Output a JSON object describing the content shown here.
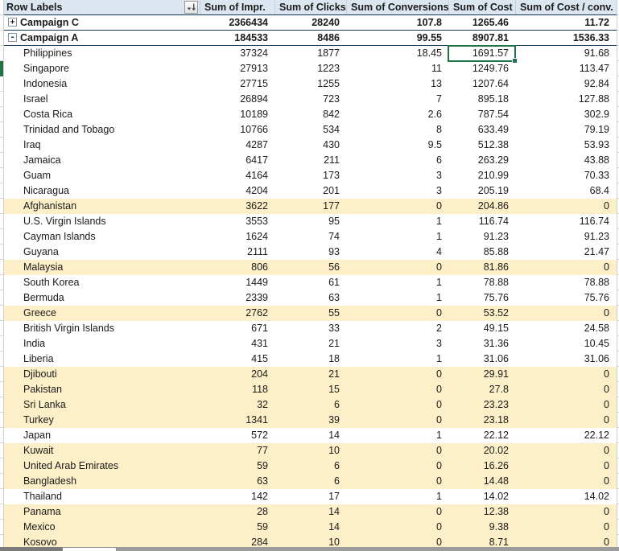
{
  "colors": {
    "header_bg": "#dce6f1",
    "campaign_border": "#17375d",
    "row_highlight": "#fdf0c8",
    "selection_green": "#217346"
  },
  "header": {
    "row_labels": "Row Labels",
    "filter_icon": "sort-filter-dropdown-icon",
    "columns": [
      "Sum of Impr.",
      "Sum of Clicks",
      "Sum of Conversions",
      "Sum of Cost",
      "Sum of Cost / conv."
    ]
  },
  "selection": {
    "row": "Philippines",
    "column": "Sum of Cost",
    "value": "1691.57",
    "row_index": 2,
    "col_index": 4
  },
  "rows": [
    {
      "label": "Campaign C",
      "type": "campaign",
      "expand": "+",
      "highlight": false,
      "values": [
        "2366434",
        "28240",
        "107.8",
        "1265.46",
        "11.72"
      ]
    },
    {
      "label": "Campaign A",
      "type": "campaign",
      "expand": "-",
      "highlight": false,
      "values": [
        "184533",
        "8486",
        "99.55",
        "8907.81",
        "1536.33"
      ]
    },
    {
      "label": "Philippines",
      "type": "country",
      "highlight": false,
      "values": [
        "37324",
        "1877",
        "18.45",
        "1691.57",
        "91.68"
      ]
    },
    {
      "label": "Singapore",
      "type": "country",
      "highlight": false,
      "values": [
        "27913",
        "1223",
        "11",
        "1249.76",
        "113.47"
      ]
    },
    {
      "label": "Indonesia",
      "type": "country",
      "highlight": false,
      "values": [
        "27715",
        "1255",
        "13",
        "1207.64",
        "92.84"
      ]
    },
    {
      "label": "Israel",
      "type": "country",
      "highlight": false,
      "values": [
        "26894",
        "723",
        "7",
        "895.18",
        "127.88"
      ]
    },
    {
      "label": "Costa Rica",
      "type": "country",
      "highlight": false,
      "values": [
        "10189",
        "842",
        "2.6",
        "787.54",
        "302.9"
      ]
    },
    {
      "label": "Trinidad and Tobago",
      "type": "country",
      "highlight": false,
      "values": [
        "10766",
        "534",
        "8",
        "633.49",
        "79.19"
      ]
    },
    {
      "label": "Iraq",
      "type": "country",
      "highlight": false,
      "values": [
        "4287",
        "430",
        "9.5",
        "512.38",
        "53.93"
      ]
    },
    {
      "label": "Jamaica",
      "type": "country",
      "highlight": false,
      "values": [
        "6417",
        "211",
        "6",
        "263.29",
        "43.88"
      ]
    },
    {
      "label": "Guam",
      "type": "country",
      "highlight": false,
      "values": [
        "4164",
        "173",
        "3",
        "210.99",
        "70.33"
      ]
    },
    {
      "label": "Nicaragua",
      "type": "country",
      "highlight": false,
      "values": [
        "4204",
        "201",
        "3",
        "205.19",
        "68.4"
      ]
    },
    {
      "label": "Afghanistan",
      "type": "country",
      "highlight": true,
      "values": [
        "3622",
        "177",
        "0",
        "204.86",
        "0"
      ]
    },
    {
      "label": "U.S. Virgin Islands",
      "type": "country",
      "highlight": false,
      "values": [
        "3553",
        "95",
        "1",
        "116.74",
        "116.74"
      ]
    },
    {
      "label": "Cayman Islands",
      "type": "country",
      "highlight": false,
      "values": [
        "1624",
        "74",
        "1",
        "91.23",
        "91.23"
      ]
    },
    {
      "label": "Guyana",
      "type": "country",
      "highlight": false,
      "values": [
        "2111",
        "93",
        "4",
        "85.88",
        "21.47"
      ]
    },
    {
      "label": "Malaysia",
      "type": "country",
      "highlight": true,
      "values": [
        "806",
        "56",
        "0",
        "81.86",
        "0"
      ]
    },
    {
      "label": "South Korea",
      "type": "country",
      "highlight": false,
      "values": [
        "1449",
        "61",
        "1",
        "78.88",
        "78.88"
      ]
    },
    {
      "label": "Bermuda",
      "type": "country",
      "highlight": false,
      "values": [
        "2339",
        "63",
        "1",
        "75.76",
        "75.76"
      ]
    },
    {
      "label": "Greece",
      "type": "country",
      "highlight": true,
      "values": [
        "2762",
        "55",
        "0",
        "53.52",
        "0"
      ]
    },
    {
      "label": "British Virgin Islands",
      "type": "country",
      "highlight": false,
      "values": [
        "671",
        "33",
        "2",
        "49.15",
        "24.58"
      ]
    },
    {
      "label": "India",
      "type": "country",
      "highlight": false,
      "values": [
        "431",
        "21",
        "3",
        "31.36",
        "10.45"
      ]
    },
    {
      "label": "Liberia",
      "type": "country",
      "highlight": false,
      "values": [
        "415",
        "18",
        "1",
        "31.06",
        "31.06"
      ]
    },
    {
      "label": "Djibouti",
      "type": "country",
      "highlight": true,
      "values": [
        "204",
        "21",
        "0",
        "29.91",
        "0"
      ]
    },
    {
      "label": "Pakistan",
      "type": "country",
      "highlight": true,
      "values": [
        "118",
        "15",
        "0",
        "27.8",
        "0"
      ]
    },
    {
      "label": "Sri Lanka",
      "type": "country",
      "highlight": true,
      "values": [
        "32",
        "6",
        "0",
        "23.23",
        "0"
      ]
    },
    {
      "label": "Turkey",
      "type": "country",
      "highlight": true,
      "values": [
        "1341",
        "39",
        "0",
        "23.18",
        "0"
      ]
    },
    {
      "label": "Japan",
      "type": "country",
      "highlight": false,
      "values": [
        "572",
        "14",
        "1",
        "22.12",
        "22.12"
      ]
    },
    {
      "label": "Kuwait",
      "type": "country",
      "highlight": true,
      "values": [
        "77",
        "10",
        "0",
        "20.02",
        "0"
      ]
    },
    {
      "label": "United Arab Emirates",
      "type": "country",
      "highlight": true,
      "values": [
        "59",
        "6",
        "0",
        "16.26",
        "0"
      ]
    },
    {
      "label": "Bangladesh",
      "type": "country",
      "highlight": true,
      "values": [
        "63",
        "6",
        "0",
        "14.48",
        "0"
      ]
    },
    {
      "label": "Thailand",
      "type": "country",
      "highlight": false,
      "values": [
        "142",
        "17",
        "1",
        "14.02",
        "14.02"
      ]
    },
    {
      "label": "Panama",
      "type": "country",
      "highlight": true,
      "values": [
        "28",
        "14",
        "0",
        "12.38",
        "0"
      ]
    },
    {
      "label": "Mexico",
      "type": "country",
      "highlight": true,
      "values": [
        "59",
        "14",
        "0",
        "9.38",
        "0"
      ]
    },
    {
      "label": "Kosovo",
      "type": "country",
      "highlight": true,
      "values": [
        "284",
        "10",
        "0",
        "8.71",
        "0"
      ]
    }
  ]
}
